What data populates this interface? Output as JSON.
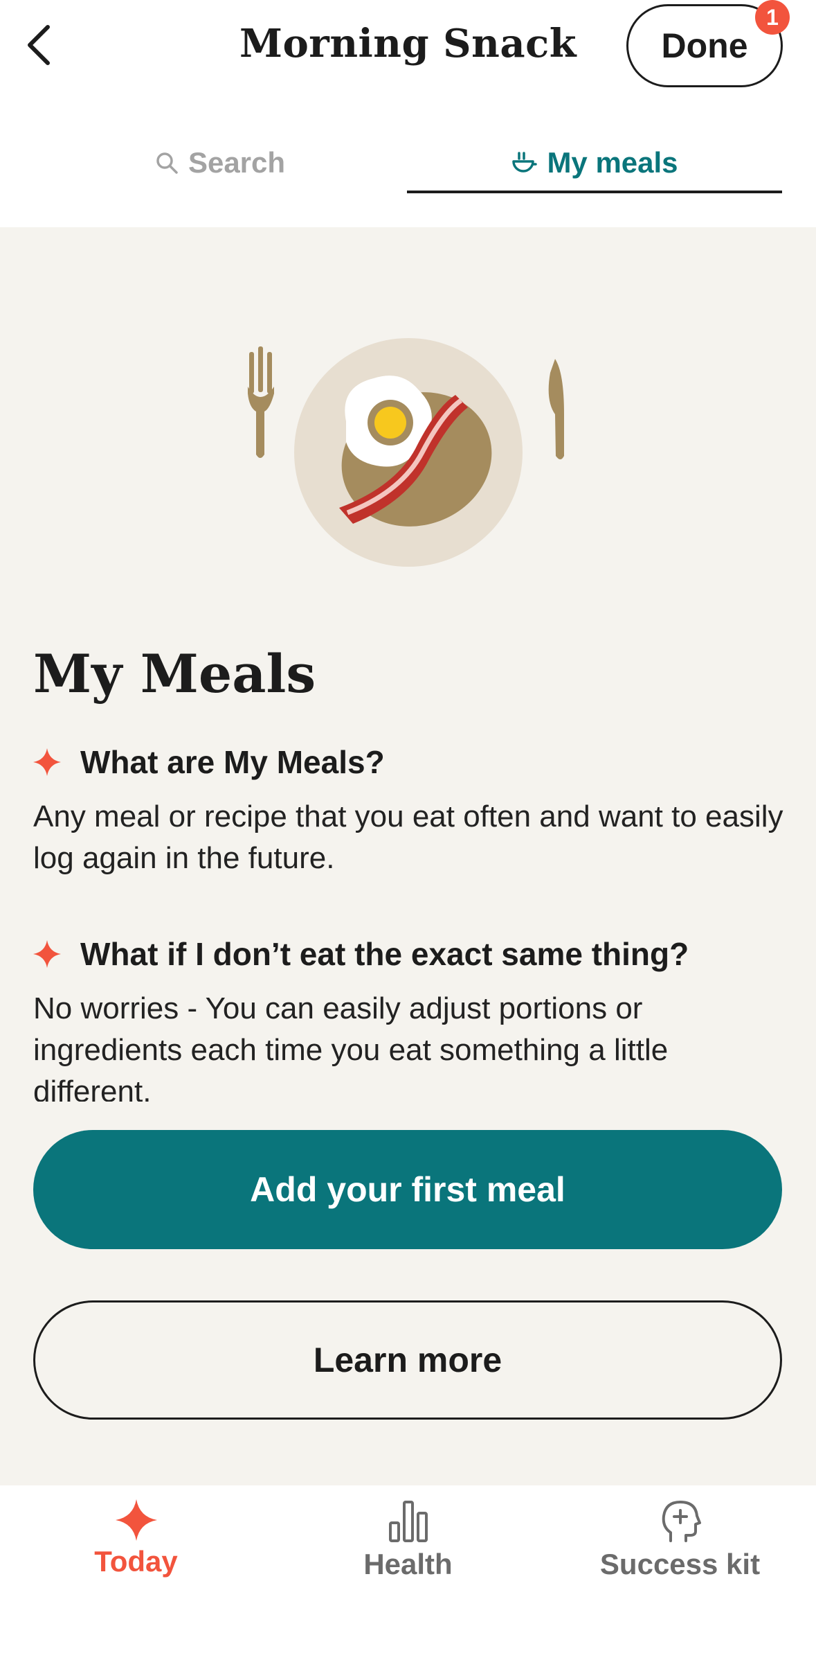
{
  "header": {
    "title": "Morning Snack",
    "done_label": "Done",
    "badge_count": "1"
  },
  "tabs": [
    {
      "label": "Search",
      "icon": "search-icon",
      "active": false
    },
    {
      "label": "My meals",
      "icon": "bowl-icon",
      "active": true
    }
  ],
  "main": {
    "title": "My Meals",
    "faqs": [
      {
        "question": "What are My Meals?",
        "answer": "Any meal or recipe that you eat often and want to easily log again in the future."
      },
      {
        "question": "What if I don’t eat the exact same thing?",
        "answer": "No worries - You can easily adjust portions or ingredients each time you eat something a little different."
      }
    ],
    "primary_button": "Add your first meal",
    "secondary_button": "Learn more"
  },
  "bottom_nav": [
    {
      "label": "Today",
      "icon": "sparkle-icon",
      "active": true
    },
    {
      "label": "Health",
      "icon": "bar-chart-icon",
      "active": false
    },
    {
      "label": "Success kit",
      "icon": "head-plus-icon",
      "active": false
    }
  ],
  "colors": {
    "accent": "#0a757b",
    "brand_red": "#f2543d",
    "background": "#f5f3ee"
  }
}
